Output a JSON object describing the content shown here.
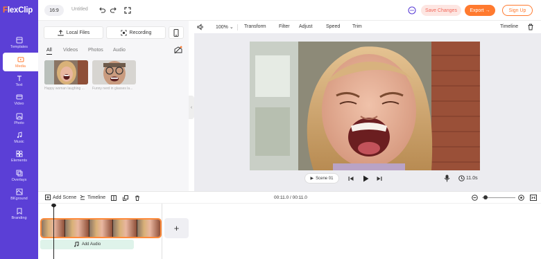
{
  "app": {
    "logo_text": "FlexClip",
    "brand_color": "#5b3fd6",
    "accent_color": "#ff7a2f"
  },
  "header": {
    "ratio": "16:9",
    "project_name": "Untitled",
    "save_label": "Save Changes",
    "export_label": "Export",
    "signup_label": "Sign Up",
    "icons": [
      "undo-icon",
      "redo-icon",
      "fullscreen-icon",
      "chat-icon"
    ]
  },
  "sidebar": {
    "items": [
      {
        "label": "Templates",
        "icon": "templates-icon"
      },
      {
        "label": "Media",
        "icon": "media-icon",
        "active": true
      },
      {
        "label": "Text",
        "icon": "text-icon"
      },
      {
        "label": "Video",
        "icon": "video-icon"
      },
      {
        "label": "Photo",
        "icon": "photo-icon"
      },
      {
        "label": "Music",
        "icon": "music-icon"
      },
      {
        "label": "Elements",
        "icon": "elements-icon"
      },
      {
        "label": "Overlays",
        "icon": "overlays-icon"
      },
      {
        "label": "BKground",
        "icon": "background-icon"
      },
      {
        "label": "Branding",
        "icon": "branding-icon"
      }
    ]
  },
  "media_panel": {
    "local_files_label": "Local Files",
    "recording_label": "Recording",
    "filter_tabs": [
      "All",
      "Videos",
      "Photos",
      "Audio"
    ],
    "active_tab": "All",
    "items": [
      {
        "caption": "Happy woman laughing ..."
      },
      {
        "caption": "Funny nerd in glasses la..."
      }
    ]
  },
  "toolbar": {
    "zoom": "100%",
    "transform": "Transform",
    "filter": "Filter",
    "adjust": "Adjust",
    "speed": "Speed",
    "trim": "Trim",
    "timeline": "Timeline"
  },
  "player": {
    "scene_label": "Scene 01",
    "duration": "11.0s"
  },
  "timeline": {
    "add_scene": "Add Scene",
    "timeline_label": "Timeline",
    "timecode": "00:11.0 / 00:11.0",
    "add_audio": "Add Audio",
    "add_button": "+",
    "zoom_level": 0.1
  }
}
